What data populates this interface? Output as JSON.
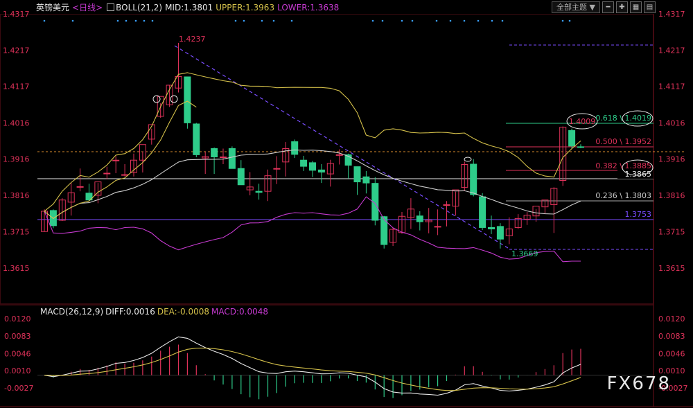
{
  "header": {
    "symbol": "英镑美元",
    "period": "<日线>",
    "indicator": "BOLL(21,2)",
    "mid": "MID:1.3801",
    "upper": "UPPER:1.3963",
    "lower": "LOWER:1.3638",
    "theme_label": "全部主题",
    "theme_arrow": "▼"
  },
  "macd_header": {
    "label": "MACD(26,12,9)",
    "diff": "DIFF:0.0016",
    "dea": "DEA:-0.0008",
    "macd": "MACD:0.0048"
  },
  "watermark": "FX678",
  "price_axis": [
    "1.4317",
    "1.4217",
    "1.4117",
    "1.4016",
    "1.3916",
    "1.3816",
    "1.3715",
    "1.3615"
  ],
  "macd_axis": [
    "0.0120",
    "0.0083",
    "0.0046",
    "0.0010",
    "-0.0027"
  ],
  "annotations": {
    "high": "1.4237",
    "low": "1.3669",
    "level_3865": "1.3865",
    "level_3753": "1.3753",
    "price_4009": "1.4009",
    "fib_618": "0.618 \\ 1.4019",
    "fib_500": "0.500 \\ 1.3952",
    "fib_382": "0.382 \\ 1.3885",
    "fib_236": "0.236 \\ 1.3803"
  },
  "colors": {
    "up": "#e0325a",
    "down": "#2ecc8a",
    "mid_line": "#cccccc",
    "upper_line": "#d4c04a",
    "lower_line": "#c63ad0",
    "accent_text": "#e0325a"
  },
  "chart_data": {
    "type": "candlestick",
    "price_axis": {
      "min": 1.3615,
      "max": 1.4317
    },
    "candles": [
      [
        1.3716,
        1.3772,
        1.3715,
        1.3777
      ],
      [
        1.3774,
        1.3732,
        1.3725,
        1.3777
      ],
      [
        1.3747,
        1.3803,
        1.3745,
        1.3808
      ],
      [
        1.3797,
        1.3823,
        1.376,
        1.385
      ],
      [
        1.384,
        1.384,
        1.3827,
        1.389
      ],
      [
        1.3822,
        1.3803,
        1.38,
        1.3848
      ],
      [
        1.3816,
        1.3853,
        1.3794,
        1.385
      ],
      [
        1.3877,
        1.3877,
        1.386,
        1.3895
      ],
      [
        1.3913,
        1.3913,
        1.3877,
        1.3924
      ],
      [
        1.3873,
        1.3873,
        1.3868,
        1.3902
      ],
      [
        1.3879,
        1.3913,
        1.3868,
        1.3931
      ],
      [
        1.3913,
        1.3956,
        1.3879,
        1.3937
      ],
      [
        1.3971,
        1.4011,
        1.3956,
        1.4
      ],
      [
        1.4034,
        1.4089,
        1.403,
        1.407
      ],
      [
        1.4066,
        1.412,
        1.406,
        1.4121
      ],
      [
        1.4112,
        1.4144,
        1.41,
        1.4237
      ],
      [
        1.4143,
        1.4016,
        1.4,
        1.4134
      ],
      [
        1.4013,
        1.3928,
        1.3921,
        1.4016
      ],
      [
        1.3919,
        1.3923,
        1.3875,
        1.3936
      ],
      [
        1.3945,
        1.3922,
        1.3875,
        1.3948
      ],
      [
        1.3922,
        1.3922,
        1.3902,
        1.3945
      ],
      [
        1.3945,
        1.389,
        1.3896,
        1.3951
      ],
      [
        1.389,
        1.3845,
        1.385,
        1.3913
      ],
      [
        1.3831,
        1.3839,
        1.3816,
        1.388
      ],
      [
        1.3827,
        1.3824,
        1.3804,
        1.3848
      ],
      [
        1.3827,
        1.387,
        1.38,
        1.3887
      ],
      [
        1.389,
        1.389,
        1.3847,
        1.3924
      ],
      [
        1.3908,
        1.3945,
        1.3868,
        1.3963
      ],
      [
        1.3964,
        1.3929,
        1.3919,
        1.397
      ],
      [
        1.3913,
        1.3896,
        1.3883,
        1.3925
      ],
      [
        1.3906,
        1.3885,
        1.3866,
        1.3911
      ],
      [
        1.3886,
        1.388,
        1.385,
        1.3902
      ],
      [
        1.3875,
        1.3904,
        1.384,
        1.3914
      ],
      [
        1.3928,
        1.3928,
        1.3901,
        1.3943
      ],
      [
        1.3928,
        1.3899,
        1.3862,
        1.3931
      ],
      [
        1.3895,
        1.3853,
        1.3817,
        1.3884
      ],
      [
        1.3867,
        1.385,
        1.3821,
        1.3883
      ],
      [
        1.3849,
        1.3747,
        1.3733,
        1.3866
      ],
      [
        1.3757,
        1.368,
        1.3669,
        1.3759
      ],
      [
        1.3686,
        1.3722,
        1.3676,
        1.3726
      ],
      [
        1.3713,
        1.3758,
        1.371,
        1.377
      ],
      [
        1.3754,
        1.3778,
        1.3723,
        1.3808
      ],
      [
        1.3759,
        1.3743,
        1.3719,
        1.3772
      ],
      [
        1.3743,
        1.3747,
        1.3711,
        1.3781
      ],
      [
        1.373,
        1.373,
        1.3706,
        1.3777
      ],
      [
        1.379,
        1.379,
        1.373,
        1.38
      ],
      [
        1.3786,
        1.3831,
        1.376,
        1.3826
      ],
      [
        1.3838,
        1.3901,
        1.3828,
        1.3909
      ],
      [
        1.3902,
        1.3818,
        1.3813,
        1.3916
      ],
      [
        1.3812,
        1.3727,
        1.372,
        1.3822
      ],
      [
        1.3727,
        1.3723,
        1.3709,
        1.376
      ],
      [
        1.373,
        1.3695,
        1.3669,
        1.3739
      ],
      [
        1.3704,
        1.3723,
        1.3681,
        1.3755
      ],
      [
        1.3727,
        1.3752,
        1.3723,
        1.3764
      ],
      [
        1.375,
        1.3761,
        1.3734,
        1.377
      ],
      [
        1.3759,
        1.3786,
        1.3743,
        1.3778
      ],
      [
        1.3784,
        1.3803,
        1.3765,
        1.3801
      ],
      [
        1.379,
        1.3835,
        1.3712,
        1.3838
      ],
      [
        1.3857,
        1.4004,
        1.3842,
        1.4006
      ],
      [
        1.3995,
        1.3952,
        1.3945,
        1.4
      ],
      [
        1.395,
        1.3948,
        1.3946,
        1.3957
      ]
    ]
  }
}
